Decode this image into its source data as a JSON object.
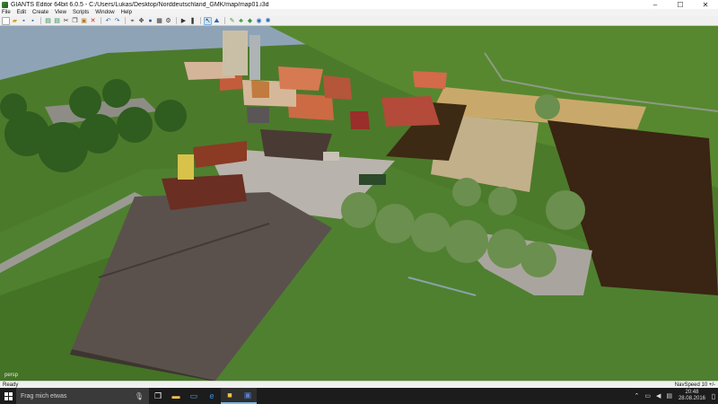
{
  "window": {
    "title": "GIANTS Editor 64bit 6.0.5 - C:/Users/Lukas/Desktop/Norddeutschland_GMK/map/map01.i3d",
    "minimize": "–",
    "maximize": "☐",
    "close": "✕"
  },
  "menu": [
    "File",
    "Edit",
    "Create",
    "View",
    "Scripts",
    "Window",
    "Help"
  ],
  "toolbar": {
    "icons": [
      "new-file-icon",
      "open-icon",
      "save-icon",
      "save-as-icon",
      "import-icon",
      "export-icon",
      "cut-icon",
      "copy-icon",
      "paste-icon",
      "delete-icon",
      "undo-icon",
      "redo-icon",
      "select-icon",
      "move-icon",
      "info-icon",
      "grid-icon",
      "settings-icon",
      "play-icon",
      "pause-icon",
      "select-mode-icon",
      "terrain-mode-icon",
      "paint-icon",
      "foliage-icon",
      "decal-icon",
      "shader-icon",
      "light-icon"
    ]
  },
  "viewport": {
    "camera_label": "persp"
  },
  "status": {
    "left": "Ready",
    "right": "NavSpeed 10 +/-"
  },
  "taskbar": {
    "search_placeholder": "Frag mich etwas",
    "time": "20:48",
    "date": "28.08.2016"
  }
}
